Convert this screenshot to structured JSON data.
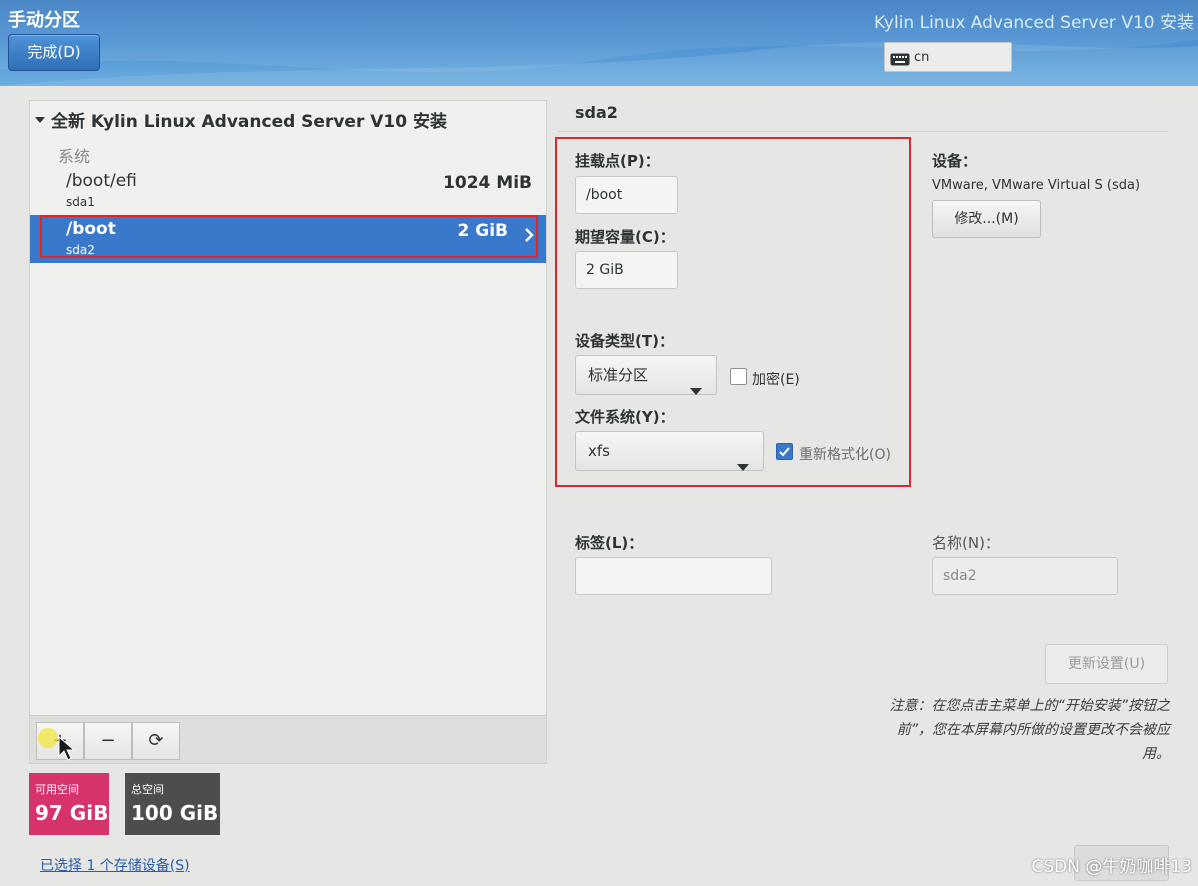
{
  "header": {
    "title": "手动分区",
    "done_button": "完成(D)",
    "product": "Kylin Linux Advanced Server V10 安装",
    "keyboard_layout": "cn"
  },
  "left": {
    "install_heading": "全新 Kylin Linux Advanced Server V10 安装",
    "group_label": "系统",
    "partitions": [
      {
        "mount": "/boot/efi",
        "device": "sda1",
        "size": "1024 MiB",
        "selected": false
      },
      {
        "mount": "/boot",
        "device": "sda2",
        "size": "2 GiB",
        "selected": true
      }
    ],
    "toolbar": {
      "add": "+",
      "remove": "−",
      "refresh": "⟳"
    },
    "available_space": {
      "label": "可用空间",
      "value": "97 GiB",
      "color": "#d6336c"
    },
    "total_space": {
      "label": "总空间",
      "value": "100 GiB",
      "color": "#4d4d4d"
    },
    "storage_link": "已选择 1 个存储设备(S)"
  },
  "right": {
    "partition_title": "sda2",
    "mount_point": {
      "label": "挂载点(P)：",
      "value": "/boot"
    },
    "desired_capacity": {
      "label": "期望容量(C)：",
      "value": "2 GiB"
    },
    "device_type": {
      "label": "设备类型(T)：",
      "value": "标准分区",
      "encrypt_label": "加密(E)",
      "encrypt_checked": false
    },
    "file_system": {
      "label": "文件系统(Y)：",
      "value": "xfs",
      "reformat_label": "重新格式化(O)",
      "reformat_checked": true
    },
    "device": {
      "label": "设备：",
      "value": "VMware, VMware Virtual S (sda)",
      "modify_button": "修改...(M)"
    },
    "tag": {
      "label": "标签(L)：",
      "value": ""
    },
    "name": {
      "label": "名称(N)：",
      "value": "sda2"
    },
    "update_button": "更新设置(U)",
    "note_line1": "注意：在您点击主菜单上的“开始安装”按钮之",
    "note_line2": "前”，您在本屏幕内所做的设置更改不会被应",
    "note_line3": "用。"
  },
  "watermark": "CSDN @牛奶咖啡13",
  "colors": {
    "selection": "#3a78cc",
    "highlight_border": "#e0262b",
    "header": "#4a8fd0"
  }
}
